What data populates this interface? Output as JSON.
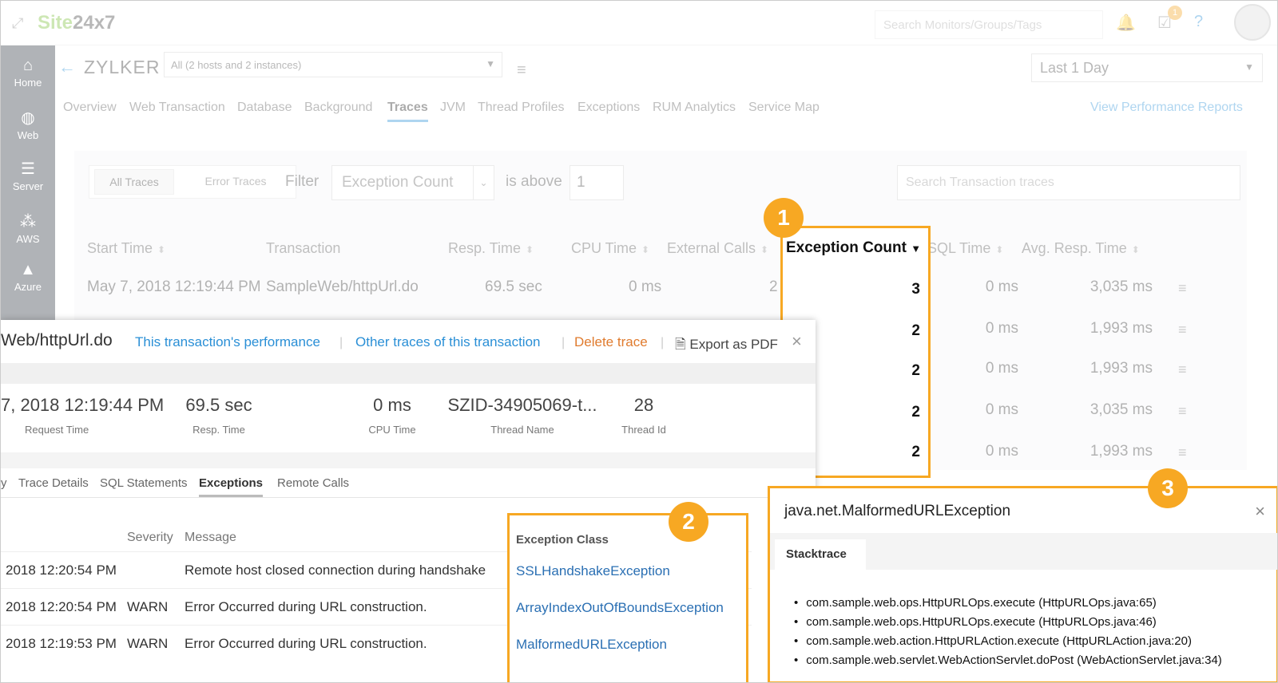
{
  "app": {
    "logo_green": "Site",
    "logo_dark": "24x7"
  },
  "top": {
    "search_placeholder": "Search Monitors/Groups/Tags",
    "notification_count": "1"
  },
  "sidebar": {
    "items": [
      {
        "label": "Home",
        "icon": "home-icon"
      },
      {
        "label": "Web",
        "icon": "globe-icon"
      },
      {
        "label": "Server",
        "icon": "server-icon"
      },
      {
        "label": "AWS",
        "icon": "aws-icon"
      },
      {
        "label": "Azure",
        "icon": "azure-icon"
      }
    ]
  },
  "header": {
    "title": "ZYLKER",
    "host_select": "All (2 hosts and 2 instances)",
    "time_range": "Last 1 Day",
    "view_reports": "View Performance Reports"
  },
  "tabs": [
    "Overview",
    "Web Transaction",
    "Database",
    "Background",
    "Traces",
    "JVM",
    "Thread Profiles",
    "Exceptions",
    "RUM Analytics",
    "Service Map"
  ],
  "filter": {
    "all_traces": "All Traces",
    "error_traces": "Error Traces",
    "label": "Filter",
    "field": "Exception Count",
    "op": "is above",
    "value": "1",
    "search_placeholder": "Search Transaction traces"
  },
  "table": {
    "columns": {
      "start": "Start Time",
      "txn": "Transaction",
      "resp": "Resp. Time",
      "cpu": "CPU Time",
      "ext": "External Calls",
      "exc": "Exception Count",
      "sql": "SQL Time",
      "avg": "Avg. Resp. Time"
    },
    "first_row": {
      "start": "May 7, 2018 12:19:44 PM",
      "txn": "SampleWeb/httpUrl.do",
      "resp": "69.5 sec",
      "cpu": "0 ms",
      "ext": "2"
    },
    "rows": [
      {
        "exc": "3",
        "sql": "0 ms",
        "avg": "3,035 ms"
      },
      {
        "exc": "2",
        "sql": "0 ms",
        "avg": "1,993 ms"
      },
      {
        "exc": "2",
        "sql": "0 ms",
        "avg": "1,993 ms"
      },
      {
        "exc": "2",
        "sql": "0 ms",
        "avg": "3,035 ms"
      },
      {
        "exc": "2",
        "sql": "0 ms",
        "avg": "1,993 ms"
      }
    ]
  },
  "callouts": [
    "1",
    "2",
    "3"
  ],
  "panel": {
    "title": "Web/httpUrl.do",
    "links": {
      "perf": "This transaction's performance",
      "other": "Other traces of this transaction",
      "delete": "Delete trace",
      "pdf": "Export as PDF"
    },
    "metrics": [
      {
        "value": "7, 2018 12:19:44 PM",
        "label": "Request Time"
      },
      {
        "value": "69.5 sec",
        "label": "Resp. Time"
      },
      {
        "value": "0 ms",
        "label": "CPU Time"
      },
      {
        "value": "SZID-34905069-t...",
        "label": "Thread Name"
      },
      {
        "value": "28",
        "label": "Thread Id"
      }
    ],
    "tabs": [
      "y",
      "Trace Details",
      "SQL Statements",
      "Exceptions",
      "Remote Calls"
    ],
    "ex_cols": {
      "severity": "Severity",
      "message": "Message",
      "class": "Exception Class"
    },
    "ex_rows": [
      {
        "time": "2018 12:20:54 PM",
        "sev": "",
        "msg": "Remote host closed connection during handshake",
        "cls": "SSLHandshakeException"
      },
      {
        "time": "2018 12:20:54 PM",
        "sev": "WARN",
        "msg": "Error Occurred during URL construction.",
        "cls": "ArrayIndexOutOfBoundsException"
      },
      {
        "time": "2018 12:19:53 PM",
        "sev": "WARN",
        "msg": "Error Occurred during URL construction.",
        "cls": "MalformedURLException"
      }
    ]
  },
  "stack": {
    "title": "java.net.MalformedURLException",
    "tab": "Stacktrace",
    "lines": [
      "com.sample.web.ops.HttpURLOps.execute (HttpURLOps.java:65)",
      "com.sample.web.ops.HttpURLOps.execute (HttpURLOps.java:46)",
      "com.sample.web.action.HttpURLAction.execute (HttpURLAction.java:20)",
      "com.sample.web.servlet.WebActionServlet.doPost (WebActionServlet.java:34)"
    ]
  },
  "colors": {
    "accent": "#2a8fd6",
    "highlight": "#f7a823",
    "delete": "#e07b2e"
  }
}
